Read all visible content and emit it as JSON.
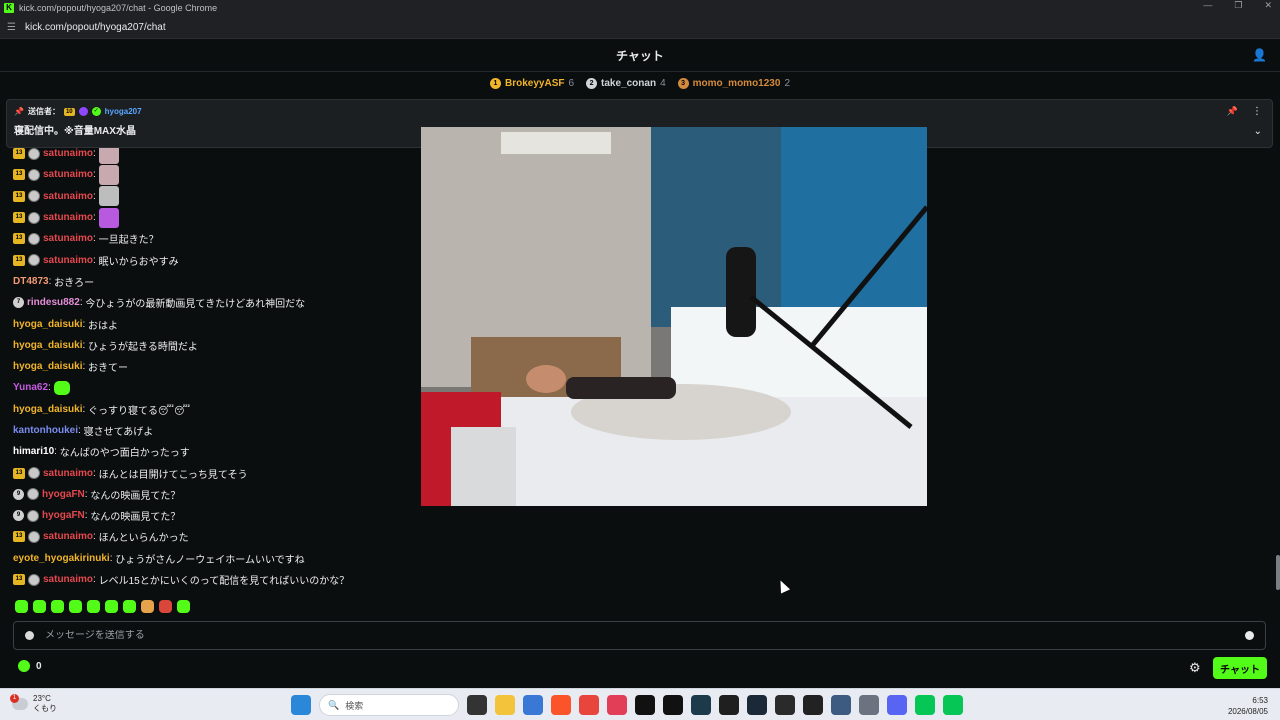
{
  "browser": {
    "window_title": "kick.com/popout/hyoga207/chat - Google Chrome",
    "url": "kick.com/popout/hyoga207/chat",
    "logo_letter": "K",
    "minimize": "—",
    "restore": "❐",
    "close": "✕"
  },
  "chat_header": {
    "title": "チャット"
  },
  "leaderboard": [
    {
      "rank": "1",
      "name": "BrokeyyASF",
      "count": "6",
      "color": "#f0b429"
    },
    {
      "rank": "2",
      "name": "take_conan",
      "count": "4",
      "color": "#d0d4d8"
    },
    {
      "rank": "3",
      "name": "momo_momo1230",
      "count": "2",
      "color": "#d48a3c"
    }
  ],
  "pinned": {
    "label": "送信者：",
    "badge_sub": "10",
    "user": "hyoga207",
    "message": "寝配信中。※音量MAX水晶"
  },
  "messages": [
    {
      "badges": [
        "13",
        "av"
      ],
      "user": "satunaimo",
      "color": "#e5484d",
      "text": "",
      "emote": "pink"
    },
    {
      "badges": [
        "13",
        "av"
      ],
      "user": "satunaimo",
      "color": "#e5484d",
      "text": "",
      "emote": "pink"
    },
    {
      "badges": [
        "13",
        "av"
      ],
      "user": "satunaimo",
      "color": "#e5484d",
      "text": "",
      "emote": "gray"
    },
    {
      "badges": [
        "13",
        "av"
      ],
      "user": "satunaimo",
      "color": "#e5484d",
      "text": "",
      "emote": "purple"
    },
    {
      "badges": [
        "13",
        "av"
      ],
      "user": "satunaimo",
      "color": "#e5484d",
      "text": "一旦起きた？",
      "emote": ""
    },
    {
      "badges": [
        "13",
        "av"
      ],
      "user": "satunaimo",
      "color": "#e5484d",
      "text": "眠いからおやすみ",
      "emote": ""
    },
    {
      "badges": [],
      "user": "DT4873",
      "color": "#f29b74",
      "text": "おきろー",
      "emote": ""
    },
    {
      "badges": [
        "7"
      ],
      "user": "rindesu882",
      "color": "#e58fd8",
      "text": "今ひょうがの最新動画見てきたけどあれ神回だな",
      "emote": ""
    },
    {
      "badges": [],
      "user": "hyoga_daisuki",
      "color": "#f0b429",
      "text": "おはよ",
      "emote": ""
    },
    {
      "badges": [],
      "user": "hyoga_daisuki",
      "color": "#f0b429",
      "text": "ひょうが起きる時間だよ",
      "emote": ""
    },
    {
      "badges": [],
      "user": "hyoga_daisuki",
      "color": "#f0b429",
      "text": "おきてー",
      "emote": ""
    },
    {
      "badges": [],
      "user": "Yuna62",
      "color": "#c45ce0",
      "text": "",
      "emote": "green"
    },
    {
      "badges": [],
      "user": "hyoga_daisuki",
      "color": "#f0b429",
      "text": "ぐっすり寝てる😴😴",
      "emote": ""
    },
    {
      "badges": [],
      "user": "kantonhoukei",
      "color": "#7b8cf0",
      "text": "寝させてあげよ",
      "emote": ""
    },
    {
      "badges": [],
      "user": "himari10",
      "color": "#ffffff",
      "text": "なんばのやつ面白かったっす",
      "emote": ""
    },
    {
      "badges": [
        "13",
        "av"
      ],
      "user": "satunaimo",
      "color": "#e5484d",
      "text": "ほんとは目開けてこっち見てそう",
      "emote": ""
    },
    {
      "badges": [
        "9",
        "av"
      ],
      "user": "hyogaFN",
      "color": "#e5484d",
      "text": "なんの映画見てた？",
      "emote": ""
    },
    {
      "badges": [
        "9",
        "av"
      ],
      "user": "hyogaFN",
      "color": "#e5484d",
      "text": "なんの映画見てた？",
      "emote": ""
    },
    {
      "badges": [
        "13",
        "av"
      ],
      "user": "satunaimo",
      "color": "#e5484d",
      "text": "ほんといらんかった",
      "emote": ""
    },
    {
      "badges": [],
      "user": "eyote_hyogakirinuki",
      "color": "#f0b429",
      "text": "ひょうがさんノーウェイホームいいですね",
      "emote": ""
    },
    {
      "badges": [
        "13",
        "av"
      ],
      "user": "satunaimo",
      "color": "#e5484d",
      "text": "レベル15とかにいくのって配信を見てればいいのかな？",
      "emote": ""
    }
  ],
  "input": {
    "placeholder": "メッセージを送信する"
  },
  "footer": {
    "points": "0",
    "send_label": "チャット"
  },
  "taskbar": {
    "temperature": "23°C",
    "weather": "くもり",
    "weather_badge": "1",
    "search_placeholder": "検索",
    "time": "6:53",
    "date": "2026/08/05"
  }
}
